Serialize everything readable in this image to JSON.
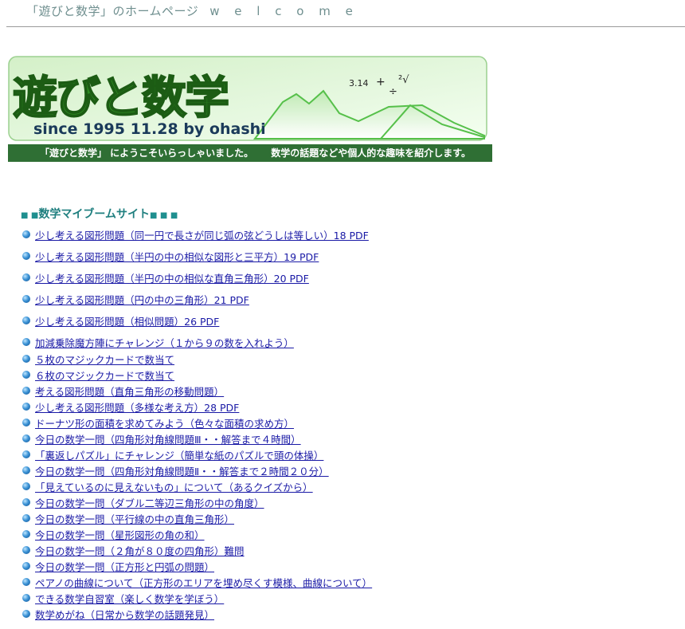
{
  "header": {
    "title": "「遊びと数学」のホームページ",
    "welcome": "w e l c o m e"
  },
  "banner": {
    "logo_text": "遊びと数学",
    "since_text": "since 1995 11.28 by ohashi",
    "math_symbols": {
      "pi": "3.14",
      "plus": "+",
      "divide": "÷",
      "root": "²√"
    }
  },
  "welcome_bar": {
    "left": "「遊びと数学」 にようこそいらっしゃいました。",
    "right": "数学の話題などや個人的な趣味を紹介します。"
  },
  "section": {
    "heading": "数学マイブームサイト",
    "squares_before": "■ ■",
    "squares_after": "■ ■ ■"
  },
  "links": [
    "少し考える図形問題（同一円で長さが同じ弧の弦どうしは等しい）18 PDF",
    "少し考える図形問題（半円の中の相似な図形と三平方）19 PDF",
    "少し考える図形問題（半円の中の相似な直角三角形）20 PDF",
    "少し考える図形問題（円の中の三角形）21 PDF",
    "少し考える図形問題（相似問題）26 PDF",
    "加減乗除魔方陣にチャレンジ（１から９の数を入れよう）",
    "５枚のマジックカードで数当て",
    "６枚のマジックカードで数当て",
    "考える図形問題（直角三角形の移動問題）",
    "少し考える図形問題（多様な考え方）28 PDF",
    "ドーナツ形の面積を求めてみよう（色々な面積の求め方）",
    "今日の数学一問（四角形対角線問題Ⅲ・・解答まで４時間）",
    "「裏返しパズル」にチャレンジ（簡単な紙のパズルで頭の体操）",
    "今日の数学一問（四角形対角線問題Ⅱ・・解答まで２時間２０分）",
    "「見えているのに見えないもの」について（あるクイズから）",
    "今日の数学一問（ダブル二等辺三角形の中の角度）",
    "今日の数学一問（平行線の中の直角三角形）",
    "今日の数学一問（星形図形の角の和）",
    "今日の数学一問（２角が８０度の四角形）難問",
    "今日の数学一問（正方形と円弧の問題）",
    "ペアノの曲線について（正方形のエリアを埋め尽くす模様、曲線について）",
    "できる数学自習室（楽しく数学を学ぼう）",
    "数学めがね（日常から数学の話題発見）"
  ],
  "colors": {
    "heading_teal": "#1f7f7f",
    "link_blue": "#1a1aa6",
    "welcome_bar_green": "#2f6f34",
    "logo_green": "#2e8b22",
    "banner_bg": "#dcf3d4"
  }
}
